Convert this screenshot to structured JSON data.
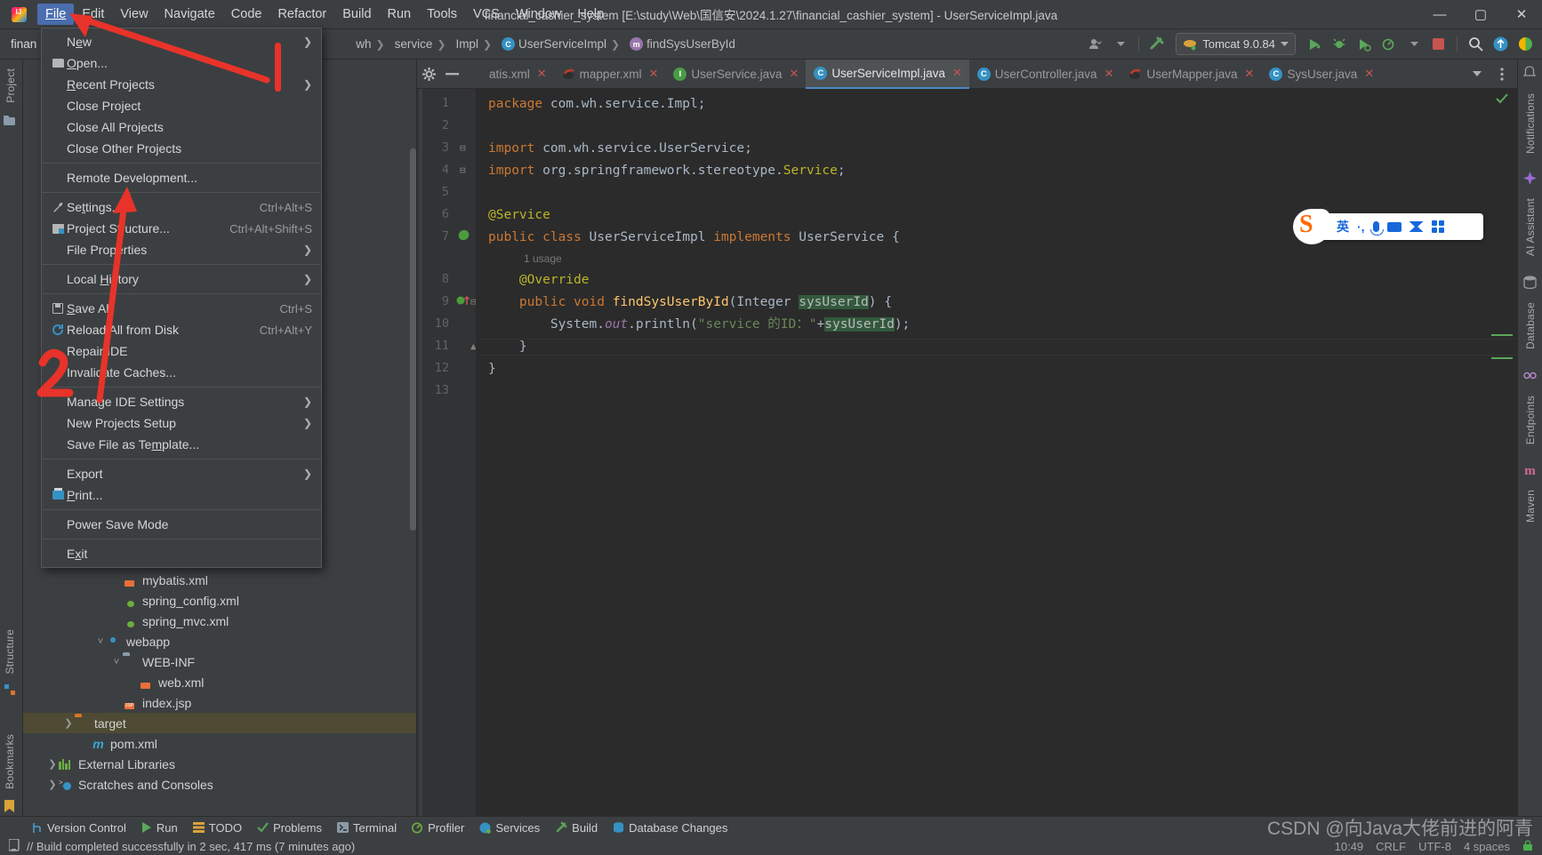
{
  "window": {
    "title": "financial_cashier_system [E:\\study\\Web\\国信安\\2024.1.27\\financial_cashier_system] - UserServiceImpl.java",
    "minimize": "—",
    "maximize": "▢",
    "close": "✕"
  },
  "menubar": {
    "items": [
      {
        "label": "File",
        "active": true
      },
      {
        "label": "Edit",
        "active": false
      },
      {
        "label": "View",
        "active": false
      },
      {
        "label": "Navigate",
        "active": false
      },
      {
        "label": "Code",
        "active": false
      },
      {
        "label": "Refactor",
        "active": false
      },
      {
        "label": "Build",
        "active": false
      },
      {
        "label": "Run",
        "active": false
      },
      {
        "label": "Tools",
        "active": false
      },
      {
        "label": "VCS",
        "active": false
      },
      {
        "label": "Window",
        "active": false
      },
      {
        "label": "Help",
        "active": false
      }
    ]
  },
  "file_menu": {
    "groups": [
      [
        {
          "label": "New",
          "icon": "none",
          "shortcut": "",
          "submenu": true
        },
        {
          "label": "Open...",
          "icon": "folder-icon",
          "shortcut": "",
          "submenu": false
        },
        {
          "label": "Recent Projects",
          "icon": "none",
          "shortcut": "",
          "submenu": true
        },
        {
          "label": "Close Project",
          "icon": "none",
          "shortcut": "",
          "submenu": false
        },
        {
          "label": "Close All Projects",
          "icon": "none",
          "shortcut": "",
          "submenu": false
        },
        {
          "label": "Close Other Projects",
          "icon": "none",
          "shortcut": "",
          "submenu": false
        }
      ],
      [
        {
          "label": "Remote Development...",
          "icon": "none",
          "shortcut": "",
          "submenu": false
        }
      ],
      [
        {
          "label": "Settings...",
          "icon": "wrench-icon",
          "shortcut": "Ctrl+Alt+S",
          "submenu": false
        },
        {
          "label": "Project Structure...",
          "icon": "project-structure-icon",
          "shortcut": "Ctrl+Alt+Shift+S",
          "submenu": false
        },
        {
          "label": "File Properties",
          "icon": "none",
          "shortcut": "",
          "submenu": true
        }
      ],
      [
        {
          "label": "Local History",
          "icon": "none",
          "shortcut": "",
          "submenu": true
        }
      ],
      [
        {
          "label": "Save All",
          "icon": "save-icon",
          "shortcut": "Ctrl+S",
          "submenu": false
        },
        {
          "label": "Reload All from Disk",
          "icon": "reload-icon",
          "shortcut": "Ctrl+Alt+Y",
          "submenu": false
        },
        {
          "label": "Repair IDE",
          "icon": "none",
          "shortcut": "",
          "submenu": false
        },
        {
          "label": "Invalidate Caches...",
          "icon": "none",
          "shortcut": "",
          "submenu": false
        }
      ],
      [
        {
          "label": "Manage IDE Settings",
          "icon": "none",
          "shortcut": "",
          "submenu": true
        },
        {
          "label": "New Projects Setup",
          "icon": "none",
          "shortcut": "",
          "submenu": true
        },
        {
          "label": "Save File as Template...",
          "icon": "none",
          "shortcut": "",
          "submenu": false
        }
      ],
      [
        {
          "label": "Export",
          "icon": "none",
          "shortcut": "",
          "submenu": true
        },
        {
          "label": "Print...",
          "icon": "print-icon",
          "shortcut": "",
          "submenu": false
        }
      ],
      [
        {
          "label": "Power Save Mode",
          "icon": "none",
          "shortcut": "",
          "submenu": false
        }
      ],
      [
        {
          "label": "Exit",
          "icon": "none",
          "shortcut": "",
          "submenu": false
        }
      ]
    ]
  },
  "navbar": {
    "project_label": "finan",
    "breadcrumbs": [
      {
        "label": "wh",
        "icon": "none"
      },
      {
        "label": "service",
        "icon": "none"
      },
      {
        "label": "Impl",
        "icon": "none"
      },
      {
        "label": "UserServiceImpl",
        "icon": "class-icon"
      },
      {
        "label": "findSysUserById",
        "icon": "method-icon"
      }
    ],
    "run_config": "Tomcat 9.0.84",
    "icons": [
      "account-icon",
      "build-hammer-icon",
      "run-icon",
      "debug-icon",
      "run-coverage-icon",
      "profile-icon",
      "stop-icon",
      "search-icon",
      "update-icon",
      "browser-icon"
    ]
  },
  "left_rail": {
    "top": [
      "Project"
    ],
    "bottom": [
      "Structure",
      "Bookmarks"
    ]
  },
  "right_rail": {
    "items": [
      "Notifications",
      "AI Assistant",
      "Database",
      "Endpoints",
      "Maven"
    ]
  },
  "project_tree": {
    "rows": [
      {
        "label": "mybatis.xml",
        "indent": 5,
        "icon": "xml-file-icon",
        "arrow": "",
        "selected": false
      },
      {
        "label": "spring_config.xml",
        "indent": 5,
        "icon": "spring-xml-icon",
        "arrow": "",
        "selected": false
      },
      {
        "label": "spring_mvc.xml",
        "indent": 5,
        "icon": "spring-xml-icon",
        "arrow": "",
        "selected": false
      },
      {
        "label": "webapp",
        "indent": 4,
        "icon": "webapp-folder-icon",
        "arrow": "v",
        "selected": false
      },
      {
        "label": "WEB-INF",
        "indent": 5,
        "icon": "folder-blue-icon",
        "arrow": "v",
        "selected": false
      },
      {
        "label": "web.xml",
        "indent": 6,
        "icon": "web-xml-icon",
        "arrow": "",
        "selected": false
      },
      {
        "label": "index.jsp",
        "indent": 5,
        "icon": "jsp-file-icon",
        "arrow": "",
        "selected": false
      },
      {
        "label": "target",
        "indent": 2,
        "icon": "folder-icon",
        "arrow": ">",
        "selected": true
      },
      {
        "label": "pom.xml",
        "indent": 3,
        "icon": "maven-icon",
        "arrow": "",
        "selected": false
      },
      {
        "label": "External Libraries",
        "indent": 1,
        "icon": "library-icon",
        "arrow": ">",
        "selected": false
      },
      {
        "label": "Scratches and Consoles",
        "indent": 1,
        "icon": "scratches-icon",
        "arrow": ">",
        "selected": false
      }
    ]
  },
  "editor_tabs": {
    "tabs": [
      {
        "label": "atis.xml",
        "icon": "xml-icon",
        "active": false,
        "close": "✕"
      },
      {
        "label": "mapper.xml",
        "icon": "mybatis-icon",
        "active": false,
        "close": "✕"
      },
      {
        "label": "UserService.java",
        "icon": "interface-icon",
        "active": false,
        "close": "✕"
      },
      {
        "label": "UserServiceImpl.java",
        "icon": "class-icon",
        "active": true,
        "close": "✕"
      },
      {
        "label": "UserController.java",
        "icon": "class-icon",
        "active": false,
        "close": "✕"
      },
      {
        "label": "UserMapper.java",
        "icon": "mybatis-icon",
        "active": false,
        "close": "✕"
      },
      {
        "label": "SysUser.java",
        "icon": "class-icon",
        "active": false,
        "close": "✕"
      }
    ]
  },
  "code": {
    "line_numbers": [
      "1",
      "2",
      "3",
      "4",
      "5",
      "6",
      "7",
      "8",
      "9",
      "10",
      "11",
      "12",
      "13"
    ],
    "usage_hint": "1 usage",
    "lines": [
      {
        "n": 1,
        "text": "package com.wh.service.Impl;"
      },
      {
        "n": 2,
        "text": ""
      },
      {
        "n": 3,
        "text": "import com.wh.service.UserService;"
      },
      {
        "n": 4,
        "text": "import org.springframework.stereotype.Service;"
      },
      {
        "n": 5,
        "text": ""
      },
      {
        "n": 6,
        "text": "@Service"
      },
      {
        "n": 7,
        "text": "public class UserServiceImpl implements UserService {"
      },
      {
        "n": 8,
        "text": "    @Override"
      },
      {
        "n": 9,
        "text": "    public void findSysUserById(Integer sysUserId) {"
      },
      {
        "n": 10,
        "text": "        System.out.println(\"service 的ID：\"+sysUserId);"
      },
      {
        "n": 11,
        "text": "    }"
      },
      {
        "n": 12,
        "text": "}"
      },
      {
        "n": 13,
        "text": ""
      }
    ]
  },
  "ime": {
    "mode": "英",
    "punct": "·,",
    "icons": [
      "sogou-logo",
      "mic-icon",
      "keyboard-icon",
      "bowtie-icon",
      "apps-icon"
    ]
  },
  "tool_windows": {
    "items": [
      {
        "label": "Version Control",
        "icon": "branch-icon"
      },
      {
        "label": "Run",
        "icon": "run-icon"
      },
      {
        "label": "TODO",
        "icon": "todo-icon"
      },
      {
        "label": "Problems",
        "icon": "check-icon"
      },
      {
        "label": "Terminal",
        "icon": "terminal-icon"
      },
      {
        "label": "Profiler",
        "icon": "profiler-icon"
      },
      {
        "label": "Services",
        "icon": "services-icon"
      },
      {
        "label": "Build",
        "icon": "build-icon"
      },
      {
        "label": "Database Changes",
        "icon": "database-icon"
      }
    ]
  },
  "status_bar": {
    "message": "// Build completed successfully in 2 sec, 417 ms (7 minutes ago)",
    "right": [
      "10:49",
      "CRLF",
      "UTF-8",
      "4 spaces"
    ]
  },
  "watermark": "CSDN @向Java大佬前进的阿青",
  "colors": {
    "accent": "#4b6eaf",
    "annotation": "#e8332a",
    "selected_row": "#4e4a33",
    "panel": "#3c3f41",
    "editor_bg": "#2b2b2b"
  }
}
